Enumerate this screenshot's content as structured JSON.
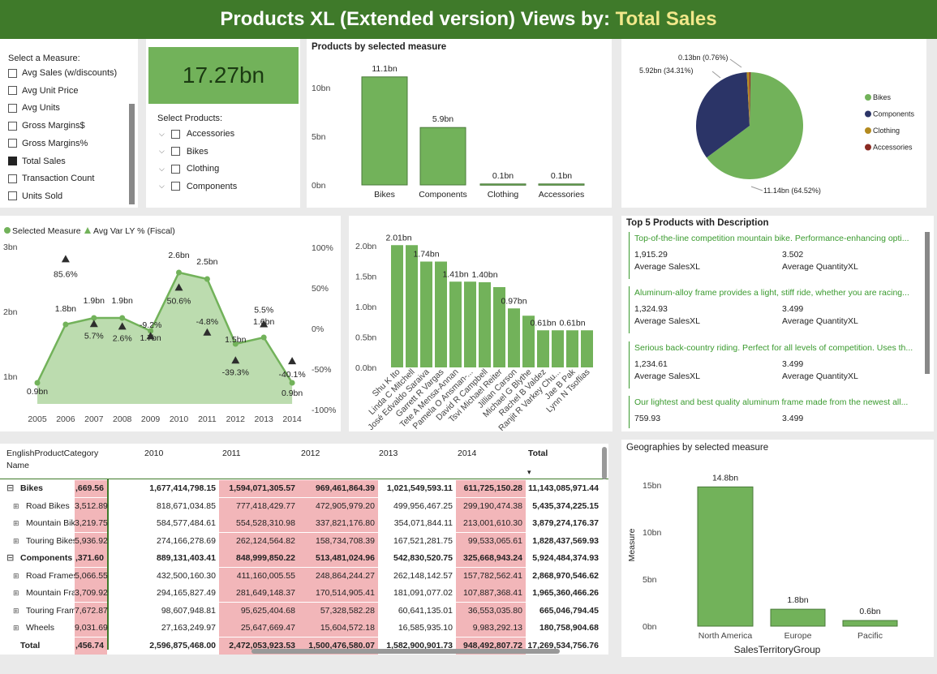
{
  "title": {
    "prefix": "Products XL (Extended version) Views by:",
    "measure": "Total Sales"
  },
  "measure_slicer": {
    "heading": "Select a Measure:",
    "items": [
      {
        "label": "Avg Sales (w/discounts)",
        "checked": false
      },
      {
        "label": "Avg Unit Price",
        "checked": false
      },
      {
        "label": "Avg Units",
        "checked": false
      },
      {
        "label": "Gross Margins$",
        "checked": false
      },
      {
        "label": "Gross Margins%",
        "checked": false
      },
      {
        "label": "Total Sales",
        "checked": true
      },
      {
        "label": "Transaction Count",
        "checked": false
      },
      {
        "label": "Units Sold",
        "checked": false
      }
    ]
  },
  "kpi": {
    "value": "17.27bn"
  },
  "product_slicer": {
    "heading": "Select Products:",
    "items": [
      "Accessories",
      "Bikes",
      "Clothing",
      "Components"
    ]
  },
  "colors": {
    "green": "#72b25a",
    "dark_green": "#3f7a2a",
    "navy": "#2b3467",
    "olive": "#b38a1f",
    "brown": "#8a2a22",
    "red_cell": "#f2b6b9",
    "title_highlight": "#f2e88a"
  },
  "products_chart": {
    "title": "Products by selected measure",
    "chart_data": {
      "type": "bar",
      "categories": [
        "Bikes",
        "Components",
        "Clothing",
        "Accessories"
      ],
      "values": [
        11.1,
        5.9,
        0.1,
        0.1
      ],
      "data_labels": [
        "11.1bn",
        "5.9bn",
        "0.1bn",
        "0.1bn"
      ],
      "y_ticks": [
        "0bn",
        "5bn",
        "10bn"
      ],
      "ylim": [
        0,
        12.5
      ]
    }
  },
  "pie_chart": {
    "chart_data": {
      "type": "pie",
      "labels": [
        "Bikes",
        "Components",
        "Clothing",
        "Accessories"
      ],
      "values": [
        64.52,
        34.31,
        0.76,
        0.41
      ],
      "data_labels": [
        "11.14bn (64.52%)",
        "5.92bn (34.31%)",
        "0.13bn (0.76%)",
        ""
      ],
      "legend_position": "right"
    },
    "legend": [
      "Bikes",
      "Components",
      "Clothing",
      "Accessories"
    ]
  },
  "trend_chart": {
    "legend": {
      "series1": "Selected Measure",
      "series2": "Avg Var LY % (Fiscal)"
    },
    "chart_data": {
      "type": "area",
      "x": [
        "2005",
        "2006",
        "2007",
        "2008",
        "2009",
        "2010",
        "2011",
        "2012",
        "2013",
        "2014"
      ],
      "series": [
        {
          "name": "Selected Measure",
          "values": [
            0.9,
            1.8,
            1.9,
            1.9,
            1.7,
            2.6,
            2.5,
            1.5,
            1.6,
            0.9
          ],
          "labels": [
            "0.9bn",
            "1.8bn",
            "1.9bn",
            "1.9bn",
            "1.7bn",
            "2.6bn",
            "2.5bn",
            "1.5bn",
            "1.6bn",
            "0.9bn"
          ]
        },
        {
          "name": "Avg Var LY % (Fiscal)",
          "values": [
            null,
            85.6,
            5.7,
            2.6,
            -9.2,
            50.6,
            -4.8,
            -39.3,
            5.5,
            -40.1
          ],
          "labels": [
            "",
            "85.6%",
            "5.7%",
            "2.6%",
            "-9.2%",
            "50.6%",
            "-4.8%",
            "-39.3%",
            "5.5%",
            "-40.1%"
          ]
        }
      ],
      "y_ticks": [
        "1bn",
        "2bn",
        "3bn"
      ],
      "y2_ticks": [
        "100%",
        "50%",
        "0%",
        "-50%",
        "-100%"
      ]
    }
  },
  "employee_chart": {
    "chart_data": {
      "type": "bar",
      "categories": [
        "Shu K Ito",
        "Linda C Mitchell",
        "José Edvaldo Saraiva",
        "Garrett R Vargas",
        "Tete A Mensa-Annan",
        "Pamela O Ansman-...",
        "David R Campbell",
        "Tsvi Michael Reiter",
        "Jillian Carson",
        "Michael G Blythe",
        "Rachel B Valdez",
        "Ranjit R Varkey Chu...",
        "Jae B Pak",
        "Lynn N Tsoflias"
      ],
      "values": [
        2.01,
        2.01,
        1.74,
        1.74,
        1.41,
        1.41,
        1.4,
        1.32,
        0.97,
        0.85,
        0.61,
        0.61,
        0.61,
        0.61
      ],
      "data_labels": [
        "2.01bn",
        "",
        "1.74bn",
        "",
        "1.41bn",
        "",
        "1.40bn",
        "",
        "0.97bn",
        "",
        "0.61bn",
        "",
        "0.61bn",
        ""
      ],
      "y_ticks": [
        "0.0bn",
        "0.5bn",
        "1.0bn",
        "1.5bn",
        "2.0bn"
      ],
      "ylim": [
        0,
        2.2
      ]
    }
  },
  "top5": {
    "title": "Top 5 Products with Description",
    "items": [
      {
        "desc": "Top-of-the-line competition mountain bike. Performance-enhancing opti...",
        "sales": "1,915.29",
        "qty": "3.502"
      },
      {
        "desc": "Aluminum-alloy frame provides a light, stiff ride, whether you are racing...",
        "sales": "1,324.93",
        "qty": "3.499"
      },
      {
        "desc": "Serious back-country riding. Perfect for all levels of competition. Uses th...",
        "sales": "1,234.61",
        "qty": "3.499"
      },
      {
        "desc": "Our lightest and best quality aluminum frame made from the newest all...",
        "sales": "759.93",
        "qty": "3.499"
      }
    ],
    "sales_label": "Average SalesXL",
    "qty_label": "Average QuantityXL"
  },
  "matrix": {
    "header": {
      "name1": "EnglishProductCategory",
      "name2": "Name",
      "cols": [
        "2010",
        "2011",
        "2012",
        "2013",
        "2014",
        "Total"
      ]
    },
    "rows": [
      {
        "name": "Bikes",
        "level": 0,
        "expand": "⊟",
        "vals": [
          ",669.56",
          "1,677,414,798.15",
          "1,594,071,305.57",
          "969,461,864.39",
          "1,021,549,593.11",
          "611,725,150.28",
          "11,143,085,971.44"
        ],
        "red": [
          1,
          0,
          1,
          1,
          0,
          1,
          0
        ]
      },
      {
        "name": "Road Bikes",
        "level": 1,
        "expand": "⊞",
        "vals": [
          "3,512.89",
          "818,671,034.85",
          "777,418,429.77",
          "472,905,979.20",
          "499,956,467.25",
          "299,190,474.38",
          "5,435,374,225.15"
        ],
        "red": [
          1,
          0,
          1,
          1,
          0,
          1,
          0
        ]
      },
      {
        "name": "Mountain Bikes",
        "level": 1,
        "expand": "⊞",
        "vals": [
          "3,219.75",
          "584,577,484.61",
          "554,528,310.98",
          "337,821,176.80",
          "354,071,844.11",
          "213,001,610.30",
          "3,879,274,176.37"
        ],
        "red": [
          1,
          0,
          1,
          1,
          0,
          1,
          0
        ]
      },
      {
        "name": "Touring Bikes",
        "level": 1,
        "expand": "⊞",
        "vals": [
          "5,936.92",
          "274,166,278.69",
          "262,124,564.82",
          "158,734,708.39",
          "167,521,281.75",
          "99,533,065.61",
          "1,828,437,569.93"
        ],
        "red": [
          1,
          0,
          1,
          1,
          0,
          1,
          0
        ]
      },
      {
        "name": "Components",
        "level": 0,
        "expand": "⊟",
        "vals": [
          ",371.60",
          "889,131,403.41",
          "848,999,850.22",
          "513,481,024.96",
          "542,830,520.75",
          "325,668,943.24",
          "5,924,484,374.93"
        ],
        "red": [
          1,
          0,
          1,
          1,
          0,
          1,
          0
        ]
      },
      {
        "name": "Road Frames",
        "level": 1,
        "expand": "⊞",
        "vals": [
          "5,066.55",
          "432,500,160.30",
          "411,160,005.55",
          "248,864,244.27",
          "262,148,142.57",
          "157,782,562.41",
          "2,868,970,546.62"
        ],
        "red": [
          1,
          0,
          1,
          1,
          0,
          1,
          0
        ]
      },
      {
        "name": "Mountain Frames",
        "level": 1,
        "expand": "⊞",
        "vals": [
          "3,709.92",
          "294,165,827.49",
          "281,649,148.37",
          "170,514,905.41",
          "181,091,077.02",
          "107,887,368.41",
          "1,965,360,466.26"
        ],
        "red": [
          1,
          0,
          1,
          1,
          0,
          1,
          0
        ]
      },
      {
        "name": "Touring Frames",
        "level": 1,
        "expand": "⊞",
        "vals": [
          "7,672.87",
          "98,607,948.81",
          "95,625,404.68",
          "57,328,582.28",
          "60,641,135.01",
          "36,553,035.80",
          "665,046,794.45"
        ],
        "red": [
          1,
          0,
          1,
          1,
          0,
          1,
          0
        ]
      },
      {
        "name": "Wheels",
        "level": 1,
        "expand": "⊞",
        "vals": [
          "9,031.69",
          "27,163,249.97",
          "25,647,669.47",
          "15,604,572.18",
          "16,585,935.10",
          "9,983,292.13",
          "180,758,904.68"
        ],
        "red": [
          1,
          0,
          1,
          1,
          0,
          1,
          0
        ]
      },
      {
        "name": "Total",
        "level": 0,
        "expand": "",
        "vals": [
          ",456.74",
          "2,596,875,468.00",
          "2,472,053,923.53",
          "1,500,476,580.07",
          "1,582,900,901.73",
          "948,492,807.72",
          "17,269,534,756.76"
        ],
        "red": [
          1,
          0,
          1,
          1,
          0,
          1,
          0
        ]
      }
    ]
  },
  "geo_chart": {
    "title": "Geographies by selected measure",
    "chart_data": {
      "type": "bar",
      "categories": [
        "North America",
        "Europe",
        "Pacific"
      ],
      "values": [
        14.8,
        1.8,
        0.6
      ],
      "data_labels": [
        "14.8bn",
        "1.8bn",
        "0.6bn"
      ],
      "y_ticks": [
        "0bn",
        "5bn",
        "10bn",
        "15bn"
      ],
      "ylim": [
        0,
        16
      ],
      "xlabel": "SalesTerritoryGroup",
      "ylabel": "Measure"
    }
  }
}
